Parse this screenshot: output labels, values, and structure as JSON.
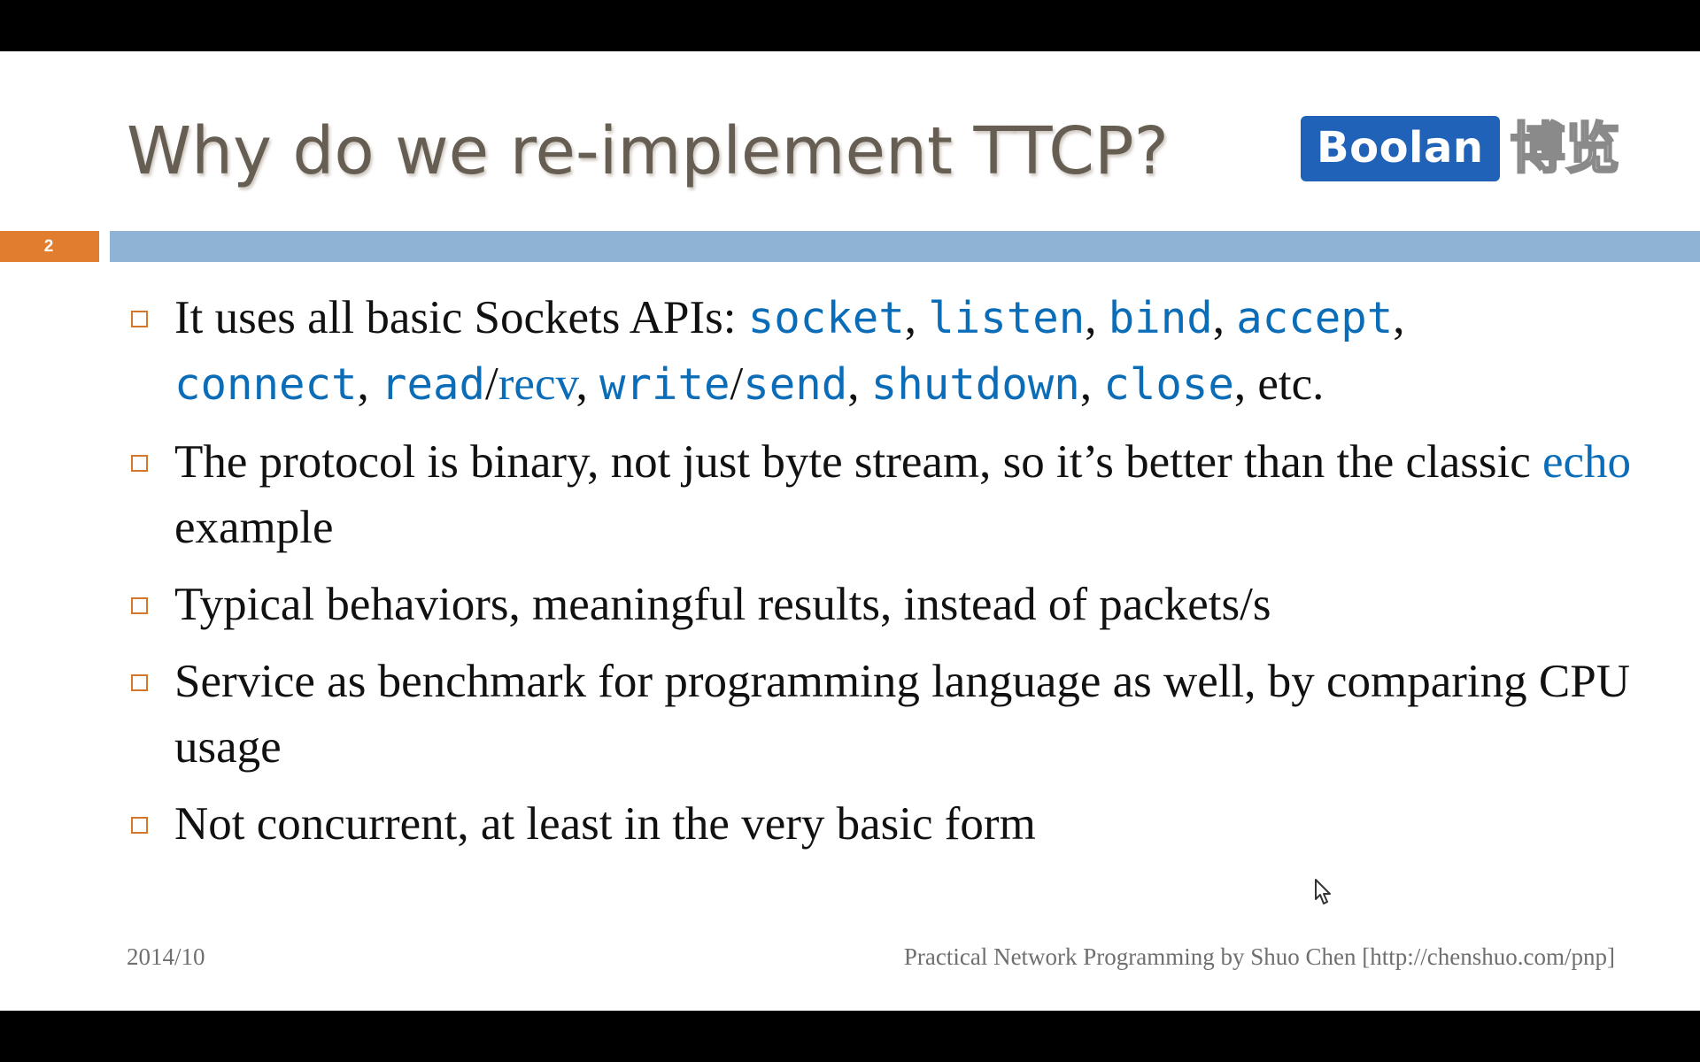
{
  "slide": {
    "number": "2",
    "title": "Why do we re-implement TTCP?",
    "logo": {
      "brand": "Boolan",
      "cn": "博览"
    }
  },
  "bullets": [
    {
      "p1": "It uses all basic Sockets APIs: ",
      "c_socket": "socket",
      "s1": ", ",
      "c_listen": "listen",
      "s2": ", ",
      "c_bind": "bind",
      "s3": ", ",
      "c_accept": "accept",
      "s4": ",",
      "c_connect": "connect",
      "s5": ", ",
      "c_read": "read",
      "slash1": "/",
      "recv": "recv",
      "s6": ", ",
      "c_write": "write",
      "slash2": "/",
      "c_send": "send",
      "s7": ", ",
      "c_shutdown": "shutdown",
      "s8": ", ",
      "c_close": "close",
      "end": ", etc."
    },
    {
      "p1": "The protocol is binary, not just byte stream, so it’s better than the classic ",
      "echo": "echo",
      "p2": " example"
    },
    {
      "text": "Typical behaviors, meaningful results, instead of packets/s"
    },
    {
      "text": "Service as benchmark for programming language as well, by comparing CPU usage"
    },
    {
      "text": "Not concurrent, at least in the very basic form"
    }
  ],
  "footer": {
    "date": "2014/10",
    "credit": "Practical Network Programming by Shuo Chen [http://chenshuo.com/pnp]"
  },
  "colors": {
    "title": "#665e52",
    "accent_orange": "#e07d2e",
    "bar_blue": "#8fb3d5",
    "code_blue": "#0b6cb8",
    "logo_blue": "#1f62b7"
  }
}
